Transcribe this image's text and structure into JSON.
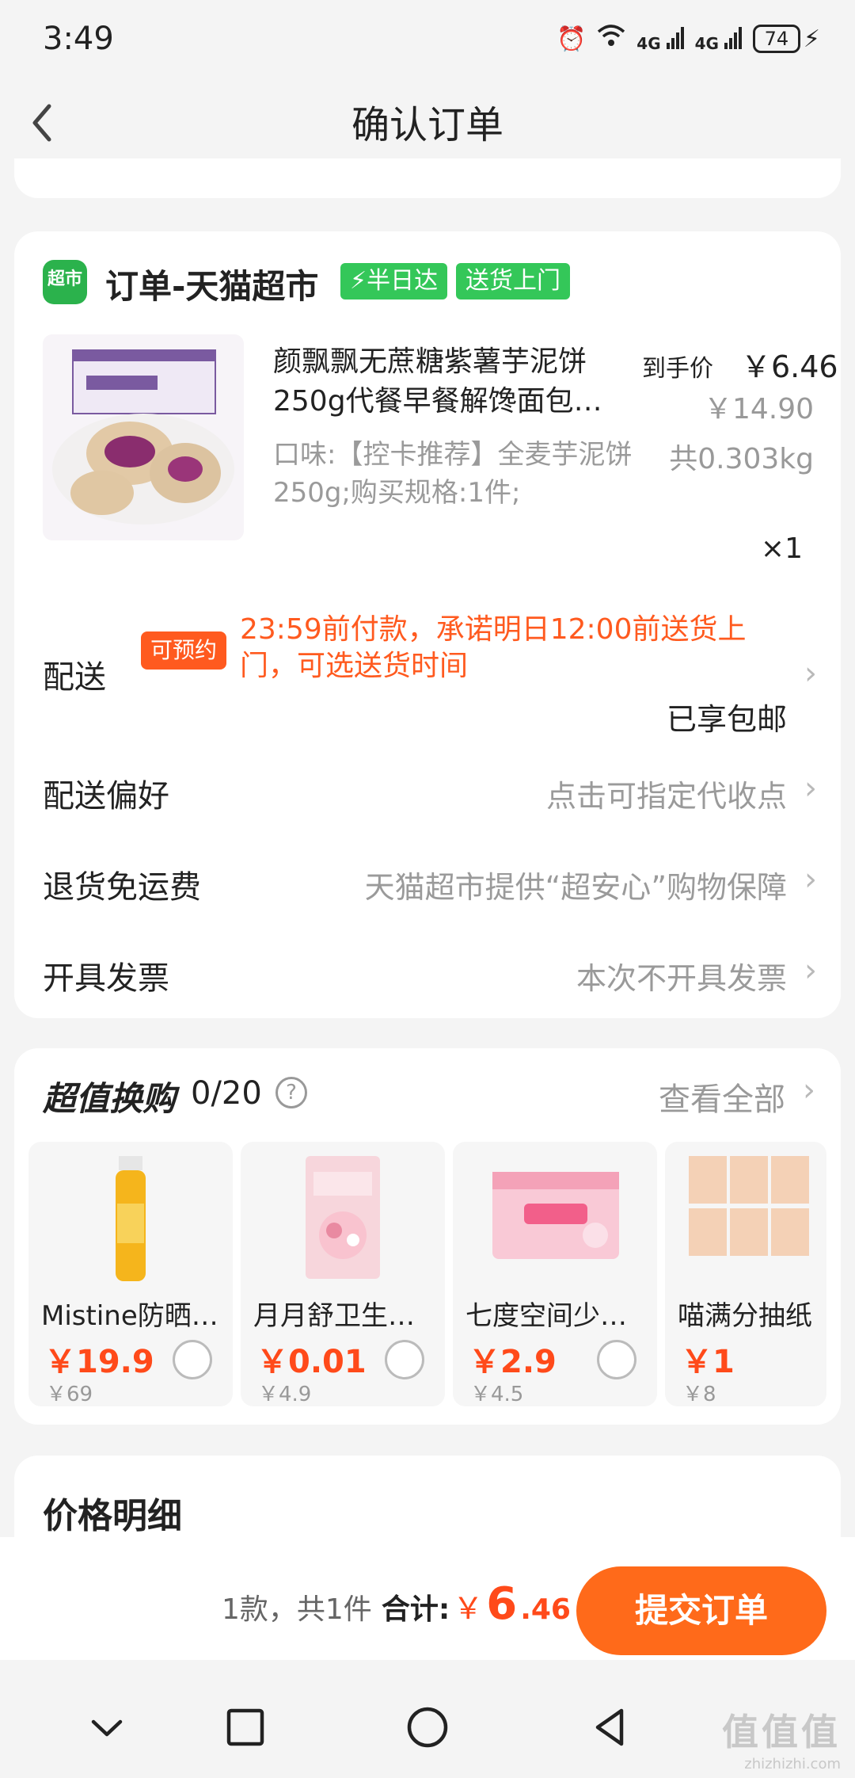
{
  "status_bar": {
    "time": "3:49",
    "network_1": "4G",
    "network_2": "4G",
    "battery": "74"
  },
  "header": {
    "title": "确认订单"
  },
  "order": {
    "store_badge": "超市",
    "store_name": "订单-天猫超市",
    "tag_half_day": "⚡半日达",
    "tag_delivery": "送货上门",
    "product_title": "颜飘飘无蔗糖紫薯芋泥饼250g代餐早餐解馋面包…",
    "final_price_label": "到手价",
    "final_price": "￥6.46",
    "original_price": "￥14.90",
    "spec": "口味:【控卡推荐】全麦芋泥饼250g;购买规格:1件;",
    "weight": "共0.303kg",
    "quantity": "×1",
    "delivery_label": "配送",
    "booking_badge": "可预约",
    "delivery_desc": "23:59前付款，承诺明日12:00前送货上门，可选送货时间",
    "free_shipping": "已享包邮",
    "pref_label": "配送偏好",
    "pref_value": "点击可指定代收点",
    "return_label": "退货免运费",
    "return_value": "天猫超市提供“超安心”购物保障",
    "invoice_label": "开具发票",
    "invoice_value": "本次不开具发票"
  },
  "exchange": {
    "title": "超值换购",
    "count": "0/20",
    "help": "?",
    "view_all": "查看全部",
    "items": [
      {
        "name": "Mistine防晒…",
        "price": "￥19.9",
        "orig": "￥69"
      },
      {
        "name": "月月舒卫生…",
        "price": "￥0.01",
        "orig": "￥4.9"
      },
      {
        "name": "七度空间少…",
        "price": "￥2.9",
        "orig": "￥4.5"
      },
      {
        "name": "喵满分抽纸",
        "price": "￥1",
        "orig": "￥8"
      }
    ]
  },
  "price_detail": {
    "title": "价格明细"
  },
  "bottom": {
    "count_text": "1款，共1件",
    "total_label": "合计:",
    "currency": "￥",
    "total_int": "6",
    "total_dec": ".46",
    "submit": "提交订单"
  },
  "watermark": {
    "big": "值值值",
    "small": "zhizhizhi.com"
  },
  "colors": {
    "accent": "#ff6a1a",
    "price_red": "#ff4a1a",
    "tag_green": "#34c759",
    "badge_orange": "#ff5a1f"
  }
}
